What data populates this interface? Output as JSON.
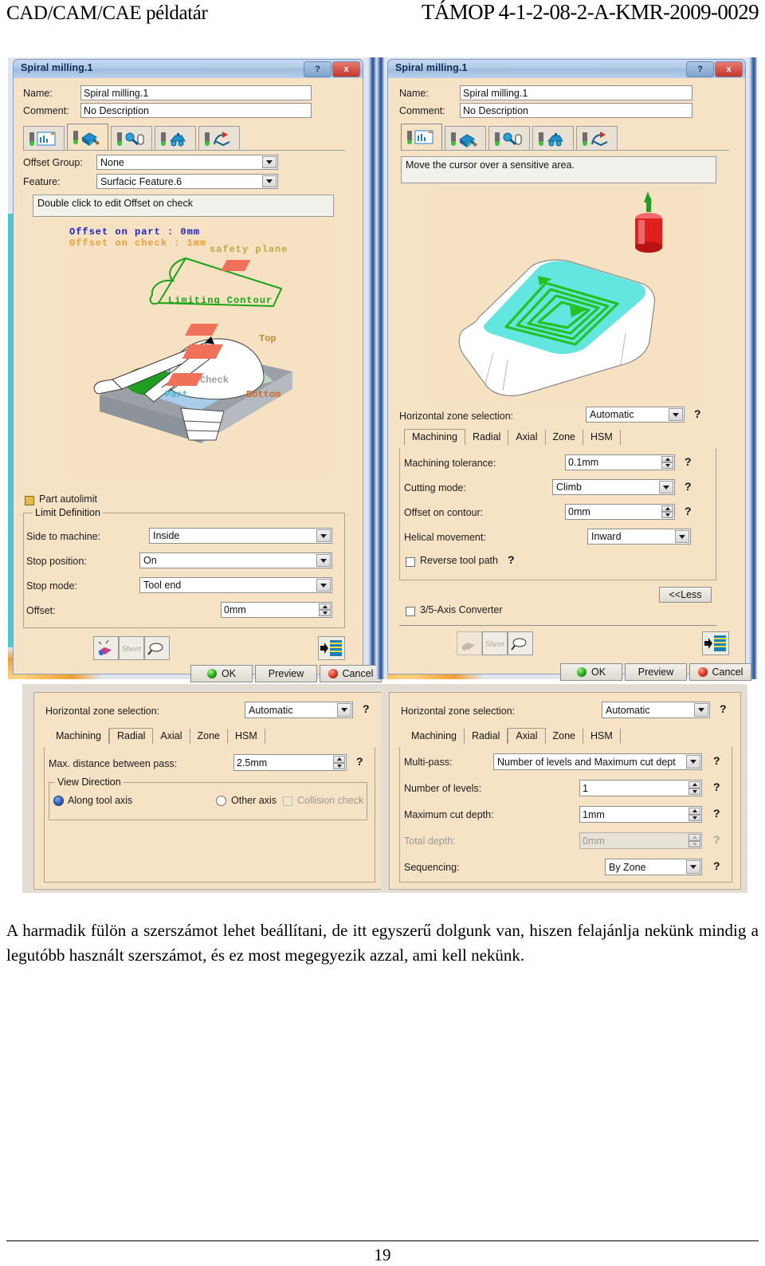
{
  "header": {
    "left": "CAD/CAM/CAE példatár",
    "right": "TÁMOP 4-1-2-08-2-A-KMR-2009-0029"
  },
  "dialog_left": {
    "title": "Spiral milling.1",
    "help_btn": "?",
    "close_btn": "x",
    "name_label": "Name:",
    "name_value": "Spiral milling.1",
    "comment_label": "Comment:",
    "comment_value": "No Description",
    "tabs": [
      {
        "name": "strategy-tab",
        "selected": false
      },
      {
        "name": "geometry-tab",
        "selected": true
      },
      {
        "name": "tool-tab",
        "selected": false
      },
      {
        "name": "feeds-speeds-tab",
        "selected": false
      },
      {
        "name": "macros-tab",
        "selected": false
      }
    ],
    "offset_group_label": "Offset Group:",
    "offset_group_value": "None",
    "feature_label": "Feature:",
    "feature_value": "Surfacic Feature.6",
    "hint": "Double click to edit Offset on check",
    "preview_labels": {
      "offset_on_part": "Offset on part : 0mm",
      "offset_on_check": "Offset on check : 1mm",
      "safety_plane": "safety plane",
      "limiting_contour": "Limiting Contour",
      "top": "Top",
      "check": "Check",
      "part": "Part",
      "bottom": "Bottom"
    },
    "part_autolimit": "Part autolimit",
    "limit_definition": "Limit Definition",
    "side_to_machine_label": "Side to machine:",
    "side_to_machine_value": "Inside",
    "stop_position_label": "Stop position:",
    "stop_position_value": "On",
    "stop_mode_label": "Stop mode:",
    "stop_mode_value": "Tool end",
    "offset_label": "Offset:",
    "offset_value": "0mm",
    "ok": "OK",
    "preview": "Preview",
    "cancel": "Cancel"
  },
  "dialog_right": {
    "title": "Spiral milling.1",
    "help_btn": "?",
    "close_btn": "x",
    "name_label": "Name:",
    "name_value": "Spiral milling.1",
    "comment_label": "Comment:",
    "comment_value": "No Description",
    "tabs": [
      {
        "name": "strategy-tab",
        "selected": true
      },
      {
        "name": "geometry-tab",
        "selected": false
      },
      {
        "name": "tool-tab",
        "selected": false
      },
      {
        "name": "feeds-speeds-tab",
        "selected": false
      },
      {
        "name": "macros-tab",
        "selected": false
      }
    ],
    "status": "Move the cursor over a sensitive area.",
    "horizontal_zone_label": "Horizontal zone selection:",
    "horizontal_zone_value": "Automatic",
    "param_tabs": [
      "Machining",
      "Radial",
      "Axial",
      "Zone",
      "HSM"
    ],
    "param_tab_selected": "Machining",
    "machining_tolerance_label": "Machining tolerance:",
    "machining_tolerance_value": "0.1mm",
    "cutting_mode_label": "Cutting mode:",
    "cutting_mode_value": "Climb",
    "offset_on_contour_label": "Offset on contour:",
    "offset_on_contour_value": "0mm",
    "helical_movement_label": "Helical movement:",
    "helical_movement_value": "Inward",
    "reverse_tool_path": "Reverse tool path",
    "less_button": "<<Less",
    "converter": "3/5-Axis Converter",
    "ok": "OK",
    "preview": "Preview",
    "cancel": "Cancel"
  },
  "panel_radial": {
    "horizontal_zone_label": "Horizontal zone selection:",
    "horizontal_zone_value": "Automatic",
    "param_tabs": [
      "Machining",
      "Radial",
      "Axial",
      "Zone",
      "HSM"
    ],
    "param_tab_selected": "Radial",
    "max_distance_label": "Max. distance between pass:",
    "max_distance_value": "2.5mm",
    "view_direction": "View Direction",
    "along_tool_axis": "Along tool axis",
    "other_axis": "Other axis",
    "collision_check": "Collision check"
  },
  "panel_axial": {
    "horizontal_zone_label": "Horizontal zone selection:",
    "horizontal_zone_value": "Automatic",
    "param_tabs": [
      "Machining",
      "Radial",
      "Axial",
      "Zone",
      "HSM"
    ],
    "param_tab_selected": "Axial",
    "multipass_label": "Multi-pass:",
    "multipass_value": "Number of levels and Maximum cut dept",
    "number_of_levels_label": "Number of levels:",
    "number_of_levels_value": "1",
    "max_cut_depth_label": "Maximum cut depth:",
    "max_cut_depth_value": "1mm",
    "total_depth_label": "Total depth:",
    "total_depth_value": "0mm",
    "sequencing_label": "Sequencing:",
    "sequencing_value": "By Zone"
  },
  "body": {
    "paragraph": "A harmadik fülön a szerszámot lehet beállítani, de itt egyszerű dolgunk van, hiszen felajánlja nekünk mindig a legutóbb használt szerszámot, és ez most megegyezik azzal, ami kell nekünk.",
    "page_number": "19"
  },
  "colors": {
    "dialog_bg": "#f6e3c6",
    "title_accent": "#9fbbe0",
    "close_red": "#c3362a",
    "toolpath_green": "#22c322",
    "zone_teal": "#4cc9cf",
    "tool_red": "#e02020"
  }
}
